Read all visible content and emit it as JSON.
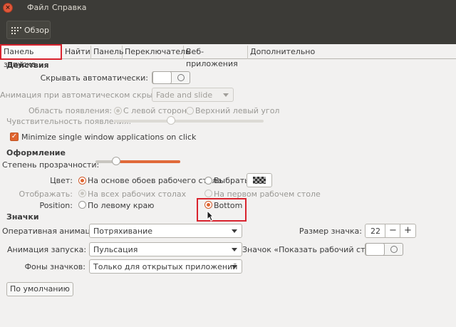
{
  "window": {
    "menu": [
      "Файл",
      "Справка"
    ]
  },
  "toolbar": {
    "overview_label": "Обзор"
  },
  "tabs": [
    {
      "label": "Панель запуска",
      "active": true
    },
    {
      "label": "Найти",
      "active": false
    },
    {
      "label": "Панель",
      "active": false
    },
    {
      "label": "Переключатель",
      "active": false
    },
    {
      "label": "Веб-приложения",
      "active": false
    },
    {
      "label": "Дополнительно",
      "active": false
    }
  ],
  "actions": {
    "title": "Действия",
    "autohide_label": "Скрывать автоматически:",
    "autohide_on": false,
    "animation_label": "Анимация при автоматическом скрытии:",
    "animation_value": "Fade and slide",
    "reveal_area_label": "Область появления:",
    "reveal_left": "С левой стороны",
    "reveal_topleft": "Верхний левый угол",
    "sensitivity_label": "Чувствительность появления:",
    "sensitivity_fraction": 0.38,
    "minimize_label": "Minimize single window applications on click",
    "minimize_checked": true
  },
  "appearance": {
    "title": "Оформление",
    "transparency_label": "Степень прозрачности:",
    "transparency_fraction": 0.24,
    "color_label": "Цвет:",
    "color_wallpaper": "На основе обоев рабочего стола",
    "color_choose": "Выбрать:",
    "display_label": "Отображать:",
    "display_all": "На всех рабочих столах",
    "display_first": "На первом рабочем столе",
    "position_label": "Position:",
    "position_left": "По левому краю",
    "position_bottom": "Bottom"
  },
  "icons": {
    "title": "Значки",
    "urgent_anim_label": "Оперативная анимация:",
    "urgent_anim_value": "Потряхивание",
    "launch_anim_label": "Анимация запуска:",
    "launch_anim_value": "Пульсация",
    "backgrounds_label": "Фоны значков:",
    "backgrounds_value": "Только для открытых приложений",
    "icon_size_label": "Размер значка:",
    "icon_size_value": "22",
    "show_desktop_label": "Значок «Показать рабочий стол»:",
    "show_desktop_on": false,
    "defaults_button": "По умолчанию"
  },
  "colors": {
    "accent": "#e0652f",
    "highlight": "#d9232e"
  }
}
